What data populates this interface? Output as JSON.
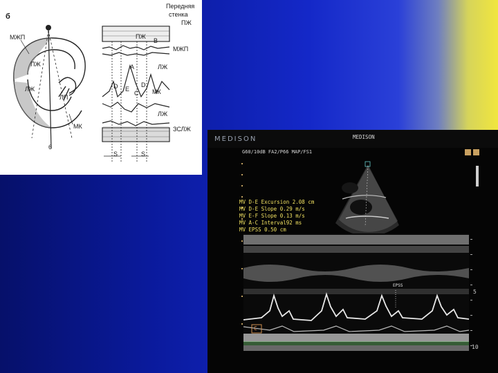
{
  "diagram": {
    "panel_label": "б",
    "labels": {
      "mzhp_left": "МЖП",
      "pzh_upper": "ПЖ",
      "lzh_left": "ЛЖ",
      "lp": "ЛП",
      "mk_left": "МК",
      "six": "6",
      "front_wall": "Передняя",
      "front_wall2": "стенка",
      "front_wall3": "ПЖ",
      "pzh_right": "ПЖ",
      "mzhp_right": "МЖП",
      "a_peak": "A",
      "d1": "D",
      "e": "E",
      "c": "C",
      "d2": "D",
      "mk_right": "МК",
      "lzh_right1": "ЛЖ",
      "lzh_right2": "ЛЖ",
      "zslzh": "ЗСЛЖ",
      "s1": "S",
      "s2": "S",
      "v": "В"
    }
  },
  "ultrasound": {
    "brand": "MEDISON",
    "header_center": "MEDISON",
    "header_left": "G60/10dB FA2/P66 MAP/FS1",
    "measurements": [
      "MV D-E Excursion  2.08 cm",
      "MV D-E Slope  0.29  m/s",
      "MV E-F Slope  0.13  m/s",
      "MV A-C Interval92  ms",
      "MV EPSS       0.50  cm"
    ],
    "scale_5": "5",
    "scale_10": "10",
    "marker_c": "C",
    "epss_label": "EPSS"
  },
  "colors": {
    "bg_dark": "#06106a",
    "bg_mid": "#1428c8",
    "bg_yellow": "#f1e63e",
    "meas_text": "#f0e060"
  }
}
